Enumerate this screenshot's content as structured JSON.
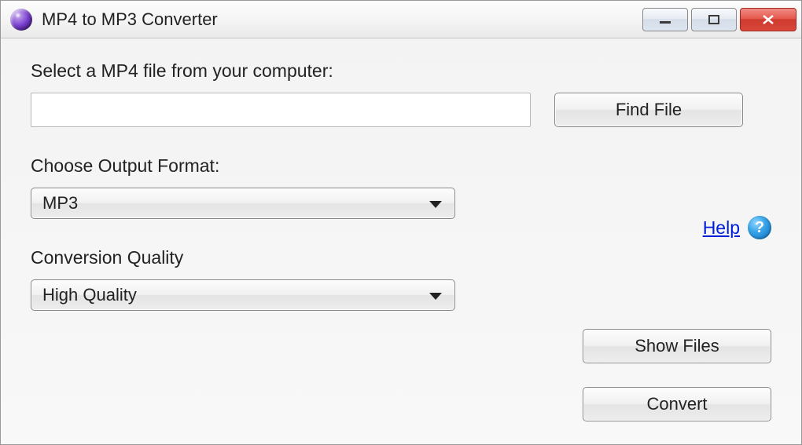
{
  "window": {
    "title": "MP4 to MP3 Converter"
  },
  "labels": {
    "select_file": "Select a MP4 file from your computer:",
    "output_format": "Choose Output Format:",
    "quality": "Conversion Quality"
  },
  "inputs": {
    "file_path": ""
  },
  "dropdowns": {
    "format_selected": "MP3",
    "quality_selected": "High Quality"
  },
  "buttons": {
    "find_file": "Find File",
    "show_files": "Show Files",
    "convert": "Convert"
  },
  "help": {
    "link_text": "Help",
    "icon_text": "?"
  }
}
